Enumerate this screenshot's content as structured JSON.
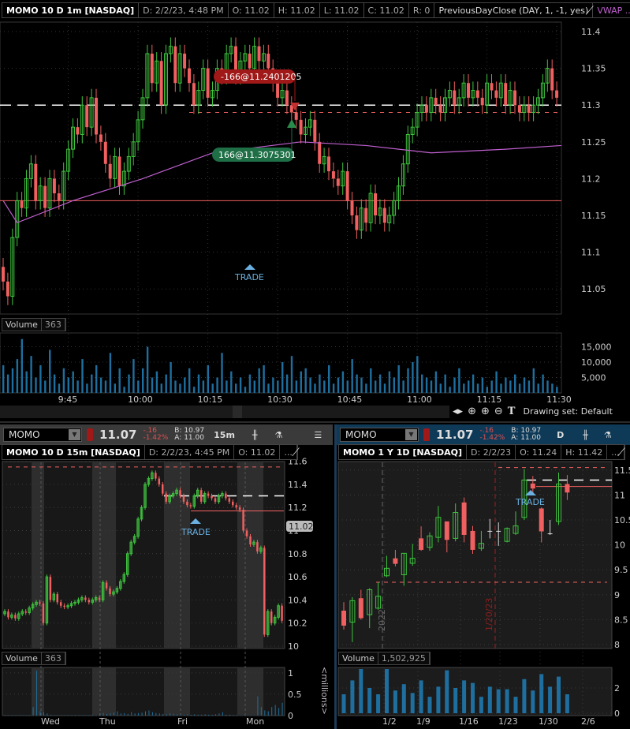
{
  "main": {
    "header": {
      "title": "MOMO 10 D 1m [NASDAQ]",
      "date": "D: 2/2/23, 4:48 PM",
      "open": "O: 11.02",
      "high": "H: 11.02",
      "low": "L: 11.02",
      "close": "C: 11.02",
      "range": "R: 0",
      "study1": "PreviousDayClose (DAY, 1, -1, yes)",
      "study2": "VWAP ..."
    },
    "volume_label": "Volume",
    "volume_value": "363",
    "sell_order": "-166@11.2401205",
    "buy_order": "166@11.3075301",
    "trade_label": "TRADE",
    "drawing_set": "Drawing set: Default"
  },
  "left_panel": {
    "symbol": "MOMO",
    "last": "11.07",
    "change": "-.16",
    "change_pct": "-1.42%",
    "bid": "B: 10.97",
    "ask": "A: 11.00",
    "aggregation": "15m",
    "header": {
      "title": "MOMO 10 D 15m [NASDAQ]",
      "date": "D: 2/2/23, 4:45 PM",
      "open": "O: 11.02",
      "more": "..."
    },
    "price_badge": "11.02",
    "volume_label": "Volume",
    "volume_value": "363",
    "volume_unit": "<millions>",
    "trade_label": "TRADE"
  },
  "right_panel": {
    "symbol": "MOMO",
    "last": "11.07",
    "change": "-.16",
    "change_pct": "-1.42%",
    "bid": "B: 10.97",
    "ask": "A: 11.00",
    "aggregation": "D",
    "header": {
      "title": "MOMO 1 Y 1D [NASDAQ]",
      "date": "D: 2/2/23",
      "open": "O: 11.24",
      "high": "H: 11.42",
      "more": "..."
    },
    "volume_label": "Volume",
    "volume_value": "1,502,925",
    "trade_label": "TRADE",
    "year_marker": "2022",
    "date_marker": "1/20/23"
  },
  "colors": {
    "up": "#3ec43e",
    "down": "#f06060",
    "vwap": "#c060d0",
    "volume": "#1e6f9f",
    "order_sell": "#a01818",
    "order_buy": "#1e6e46",
    "toolbar_right": "#0e3a58",
    "toolbar_left": "#3a3a3a"
  },
  "chart_data": [
    {
      "type": "candlestick",
      "name": "1m intraday",
      "ylim": [
        11.02,
        11.42
      ],
      "y_ticks": [
        "11.4",
        "11.35",
        "11.3",
        "11.25",
        "11.2",
        "11.15",
        "11.1",
        "11.05"
      ],
      "x_ticks": [
        "9:45",
        "10:00",
        "10:15",
        "10:30",
        "10:45",
        "11:00",
        "11:15",
        "11:30"
      ],
      "closes": [
        11.06,
        11.04,
        11.12,
        11.17,
        11.16,
        11.2,
        11.22,
        11.17,
        11.19,
        11.16,
        11.2,
        11.18,
        11.17,
        11.21,
        11.24,
        11.27,
        11.26,
        11.3,
        11.27,
        11.31,
        11.26,
        11.25,
        11.22,
        11.2,
        11.23,
        11.19,
        11.21,
        11.23,
        11.25,
        11.28,
        11.31,
        11.37,
        11.33,
        11.36,
        11.3,
        11.37,
        11.38,
        11.33,
        11.37,
        11.35,
        11.33,
        11.3,
        11.32,
        11.35,
        11.31,
        11.32,
        11.35,
        11.34,
        11.37,
        11.38,
        11.34,
        11.36,
        11.37,
        11.35,
        11.38,
        11.36,
        11.37,
        11.35,
        11.33,
        11.31,
        11.32,
        11.3,
        11.29,
        11.28,
        11.26,
        11.27,
        11.28,
        11.25,
        11.22,
        11.23,
        11.21,
        11.2,
        11.19,
        11.21,
        11.17,
        11.15,
        11.13,
        11.16,
        11.14,
        11.18,
        11.15,
        11.16,
        11.14,
        11.15,
        11.17,
        11.19,
        11.22,
        11.26,
        11.27,
        11.29,
        11.3,
        11.29,
        11.31,
        11.3,
        11.29,
        11.31,
        11.32,
        11.3,
        11.31,
        11.33,
        11.31,
        11.32,
        11.31,
        11.3,
        11.33,
        11.32,
        11.31,
        11.33,
        11.3,
        11.32,
        11.3,
        11.29,
        11.3,
        11.29,
        11.3,
        11.31,
        11.33,
        11.35,
        11.32,
        11.31
      ],
      "vwap": [
        [
          0,
          11.17
        ],
        [
          3,
          11.14
        ],
        [
          15,
          11.17
        ],
        [
          30,
          11.2
        ],
        [
          45,
          11.235
        ],
        [
          64,
          11.25
        ],
        [
          78,
          11.245
        ],
        [
          92,
          11.235
        ],
        [
          108,
          11.24
        ],
        [
          120,
          11.245
        ]
      ],
      "previous_day_close": 11.3,
      "order_line": 11.29,
      "trade_line": 11.17,
      "volume": {
        "y_ticks": [
          "15,000",
          "10,000",
          "5,000"
        ],
        "ylim": [
          0,
          20000
        ],
        "values": [
          9000,
          6000,
          8000,
          11000,
          17500,
          7000,
          12000,
          5000,
          9000,
          4000,
          14000,
          6000,
          3000,
          8000,
          5000,
          7000,
          4000,
          11000,
          3000,
          6000,
          9000,
          5000,
          4000,
          13000,
          3000,
          8000,
          2000,
          6000,
          11000,
          4000,
          8000,
          15000,
          5000,
          7000,
          3000,
          6000,
          10000,
          4000,
          3000,
          5000,
          8000,
          2000,
          6000,
          4000,
          9000,
          3000,
          5000,
          13000,
          4000,
          7000,
          3000,
          5000,
          2000,
          6000,
          4000,
          8000,
          9000,
          3000,
          5000,
          4000,
          10000,
          6000,
          12000,
          4000,
          7000,
          8000,
          5000,
          3000,
          6000,
          4000,
          9000,
          3000,
          5000,
          7000,
          4000,
          11000,
          6000,
          5000,
          3000,
          8000,
          4000,
          6000,
          3000,
          7000,
          5000,
          9000,
          4000,
          8000,
          10000,
          12000,
          6000,
          5000,
          4000,
          7000,
          3000,
          6000,
          2000,
          5000,
          8000,
          3000,
          4000,
          6000,
          3000,
          5000,
          2000,
          4000,
          7000,
          3000,
          5000,
          4000,
          6000,
          3000,
          5000,
          4000,
          8000,
          3000,
          6000,
          4000,
          3000,
          2000
        ]
      }
    },
    {
      "type": "candlestick",
      "name": "15m 10 day",
      "ylim": [
        10,
        11.6
      ],
      "y_ticks": [
        "11.6",
        "11.4",
        "11.2",
        "11",
        "10.8",
        "10.6",
        "10.4",
        "10.2",
        "10"
      ],
      "x_ticks": [
        "Wed",
        "Thu",
        "Fri",
        "Mon"
      ],
      "closes": [
        10.3,
        10.25,
        10.27,
        10.24,
        10.28,
        10.3,
        10.29,
        10.33,
        10.36,
        10.38,
        10.37,
        10.2,
        10.6,
        10.4,
        10.45,
        10.38,
        10.35,
        10.34,
        10.35,
        10.37,
        10.38,
        10.4,
        10.42,
        10.4,
        10.38,
        10.4,
        10.42,
        10.4,
        10.55,
        10.5,
        10.45,
        10.47,
        10.5,
        10.56,
        10.62,
        10.8,
        10.9,
        10.95,
        11.1,
        11.2,
        11.4,
        11.45,
        11.5,
        11.45,
        11.4,
        11.32,
        11.25,
        11.3,
        11.32,
        11.35,
        11.3,
        11.25,
        11.22,
        11.21,
        11.3,
        11.35,
        11.25,
        11.32,
        11.3,
        11.28,
        11.25,
        11.3,
        11.32,
        11.28,
        11.25,
        11.22,
        11.2,
        11.18,
        11.0,
        10.95,
        10.88,
        10.9,
        10.82,
        10.85,
        10.1,
        10.3,
        10.2,
        10.25,
        10.35,
        10.22
      ],
      "resistance_line": 11.55,
      "previous_day_close": 11.3,
      "trade_line": 11.17,
      "volume": {
        "y_ticks": [
          "1",
          "0.5",
          "0"
        ],
        "unit": "millions",
        "ylim": [
          0,
          1.2
        ],
        "values": [
          0.01,
          0.01,
          0.01,
          0.01,
          0.01,
          0.01,
          0.01,
          0.01,
          0.2,
          1.05,
          0.1,
          0.08,
          0.05,
          0.02,
          0.01,
          0.01,
          0.01,
          0.01,
          0.01,
          0.01,
          0.01,
          0.01,
          0.01,
          0.01,
          0.01,
          0.02,
          0.01,
          0.05,
          0.06,
          0.04,
          0.05,
          0.07,
          0.1,
          0.05,
          0.06,
          0.04,
          0.08,
          0.05,
          0.06,
          0.07,
          0.1,
          0.12,
          0.08,
          0.06,
          0.05,
          0.04,
          0.03,
          0.05,
          0.04,
          0.03,
          0.03,
          0.02,
          0.03,
          0.02,
          0.03,
          0.02,
          0.02,
          0.03,
          0.02,
          0.02,
          0.03,
          0.05,
          0.08,
          0.02,
          0.02,
          0.01,
          0.01,
          0.01,
          0.01,
          0.01,
          0.01,
          0.01,
          0.45,
          0.2,
          0.12,
          0.1,
          0.2,
          0.25,
          0.18,
          0.3
        ]
      }
    },
    {
      "type": "candlestick",
      "name": "1 year daily",
      "ylim": [
        8,
        11.6
      ],
      "y_ticks": [
        "11.5",
        "11",
        "10.5",
        "10",
        "9.5",
        "9",
        "8.5",
        "8"
      ],
      "x_ticks": [
        "1/2",
        "1/9",
        "1/16",
        "1/23",
        "1/30",
        "2/6"
      ],
      "ohlc": [
        [
          8.68,
          8.85,
          8.3,
          8.38
        ],
        [
          8.45,
          8.95,
          8.05,
          8.88
        ],
        [
          8.93,
          9.1,
          8.5,
          8.53
        ],
        [
          8.6,
          9.13,
          8.33,
          9.1
        ],
        [
          8.73,
          9.25,
          8.7,
          8.97
        ],
        [
          9.38,
          9.78,
          9.35,
          9.53
        ],
        [
          9.73,
          9.9,
          9.57,
          9.62
        ],
        [
          9.4,
          9.83,
          9.18,
          9.83
        ],
        [
          9.63,
          10.02,
          9.58,
          9.73
        ],
        [
          10.13,
          10.37,
          9.88,
          9.9
        ],
        [
          9.95,
          10.25,
          9.88,
          10.18
        ],
        [
          10.15,
          10.78,
          10.05,
          10.55
        ],
        [
          10.47,
          10.47,
          9.85,
          10.1
        ],
        [
          10.13,
          10.83,
          10.07,
          10.65
        ],
        [
          10.85,
          10.95,
          10.05,
          10.2
        ],
        [
          10.28,
          10.38,
          9.82,
          9.9
        ],
        [
          9.93,
          10.28,
          9.88,
          10.03
        ],
        [
          10.28,
          10.52,
          10.13,
          10.28
        ],
        [
          10.28,
          10.45,
          9.98,
          10.28
        ],
        [
          10.07,
          10.35,
          10.05,
          10.33
        ],
        [
          10.23,
          10.67,
          10.2,
          10.38
        ],
        [
          10.55,
          11.52,
          10.5,
          11.3
        ],
        [
          11.23,
          11.38,
          11.02,
          11.13
        ],
        [
          10.73,
          10.75,
          10.05,
          10.27
        ],
        [
          10.23,
          10.5,
          10.2,
          10.23
        ],
        [
          10.47,
          11.45,
          10.4,
          11.22
        ],
        [
          11.22,
          11.4,
          10.9,
          11.05
        ]
      ],
      "resistance_line": 11.55,
      "support_line": 9.25,
      "previous_day_close": 11.3,
      "trade_line": 11.17,
      "volume": {
        "y_ticks": [
          "2",
          "0"
        ],
        "unit": "millions",
        "ylim": [
          0,
          4
        ],
        "values": [
          1.5,
          2.6,
          3.5,
          2.0,
          1.5,
          3.5,
          1.8,
          2.3,
          1.6,
          2.6,
          1.3,
          2.1,
          3.4,
          2.0,
          2.6,
          2.4,
          1.3,
          2.1,
          1.9,
          1.9,
          1.3,
          2.7,
          1.8,
          3.1,
          2.1,
          2.9,
          1.5
        ]
      }
    }
  ]
}
